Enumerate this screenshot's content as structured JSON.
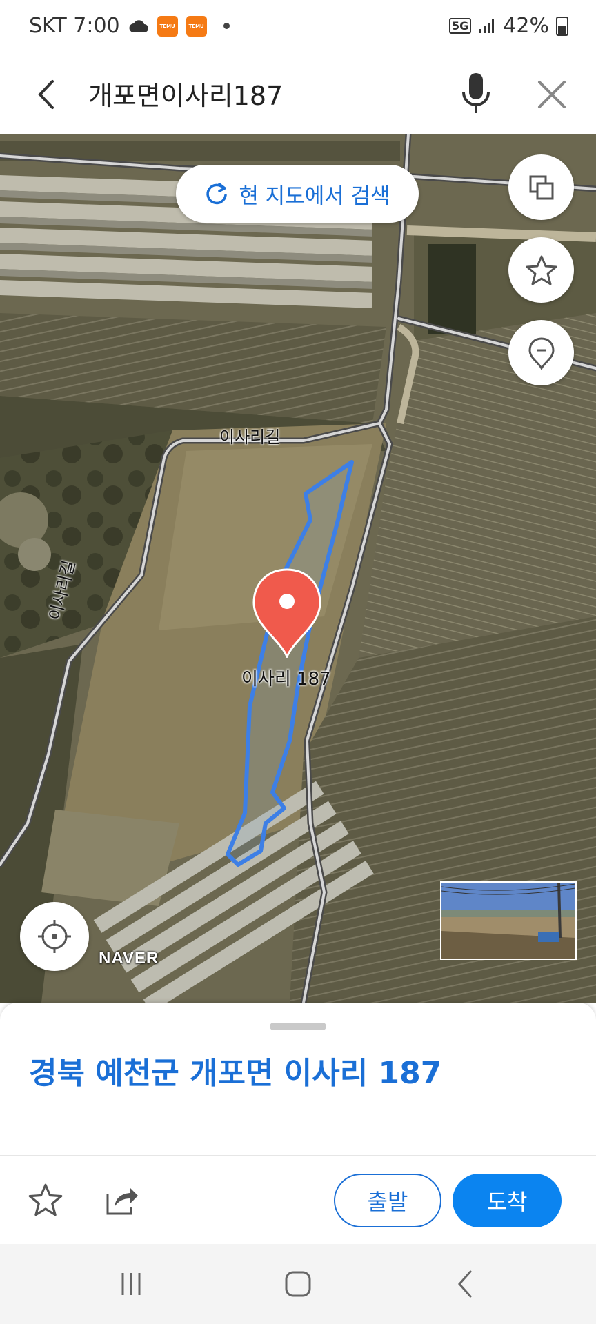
{
  "status_bar": {
    "carrier_time": "SKT 7:00",
    "app_badge_1": "TEMU",
    "app_badge_2": "TEMU",
    "network": "5G",
    "battery": "42%"
  },
  "header": {
    "query": "개포면이사리187",
    "icons": [
      "back-arrow-icon",
      "microphone-icon",
      "close-icon"
    ]
  },
  "map": {
    "search_here_label": "현 지도에서 검색",
    "road_label_top": "이사리길",
    "road_label_left": "이사리길",
    "pin_label": "이사리 187",
    "logo": "NAVER",
    "pin_color": "#f05a4c",
    "parcel_outline_color": "#3d7fe6",
    "side_buttons": [
      "layers-icon",
      "favorites-star-icon",
      "location-pin-icon"
    ]
  },
  "sheet": {
    "address": "경북 예천군 개포면 이사리 187",
    "depart_label": "출발",
    "arrive_label": "도착",
    "accent": "#1a6fd6"
  },
  "nav_bar": {
    "buttons": [
      "recent-apps-icon",
      "home-icon",
      "back-icon"
    ]
  }
}
